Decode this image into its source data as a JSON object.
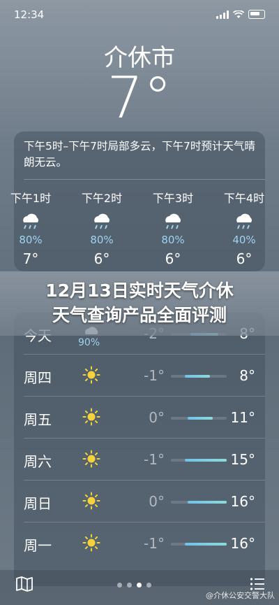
{
  "status": {
    "time": "12:34"
  },
  "location": {
    "city": "介休市",
    "temperature": "7°"
  },
  "summary": "下午5时–下午7时局部多云，下午7时预计天气晴朗无云。",
  "hourly": [
    {
      "label": "下午1时",
      "pop": "80%",
      "temp": "7°",
      "icon": "rain-cloud-icon"
    },
    {
      "label": "下午2时",
      "pop": "80%",
      "temp": "6°",
      "icon": "rain-cloud-icon"
    },
    {
      "label": "下午3时",
      "pop": "80%",
      "temp": "6°",
      "icon": "rain-cloud-icon"
    },
    {
      "label": "下午4时",
      "pop": "40%",
      "temp": "6°",
      "icon": "rain-cloud-icon"
    }
  ],
  "banner": {
    "line1": "12月13日实时天气介休",
    "line2": "天气查询产品全面评测"
  },
  "daily": [
    {
      "day": "今天",
      "pop": "90%",
      "low": "-2°",
      "high": "8°",
      "range": [
        0.35,
        0.85
      ],
      "icon": "rain-cloud-icon"
    },
    {
      "day": "周四",
      "low": "-1°",
      "high": "8°",
      "range": [
        0.25,
        0.7
      ],
      "icon": "sun-icon"
    },
    {
      "day": "周五",
      "low": "0°",
      "high": "11°",
      "range": [
        0.3,
        0.75
      ],
      "icon": "sun-icon"
    },
    {
      "day": "周六",
      "low": "-1°",
      "high": "15°",
      "range": [
        0.25,
        1.0
      ],
      "icon": "sun-icon"
    },
    {
      "day": "周日",
      "low": "0°",
      "high": "16°",
      "range": [
        0.3,
        1.0
      ],
      "icon": "sun-icon"
    },
    {
      "day": "周一",
      "low": "-1°",
      "high": "16°",
      "range": [
        0.25,
        1.0
      ],
      "icon": "sun-icon"
    }
  ],
  "watermark": "@介休公安交警大队",
  "colors": {
    "precip": "#9fd3f0",
    "sun": "#f6d23a"
  }
}
